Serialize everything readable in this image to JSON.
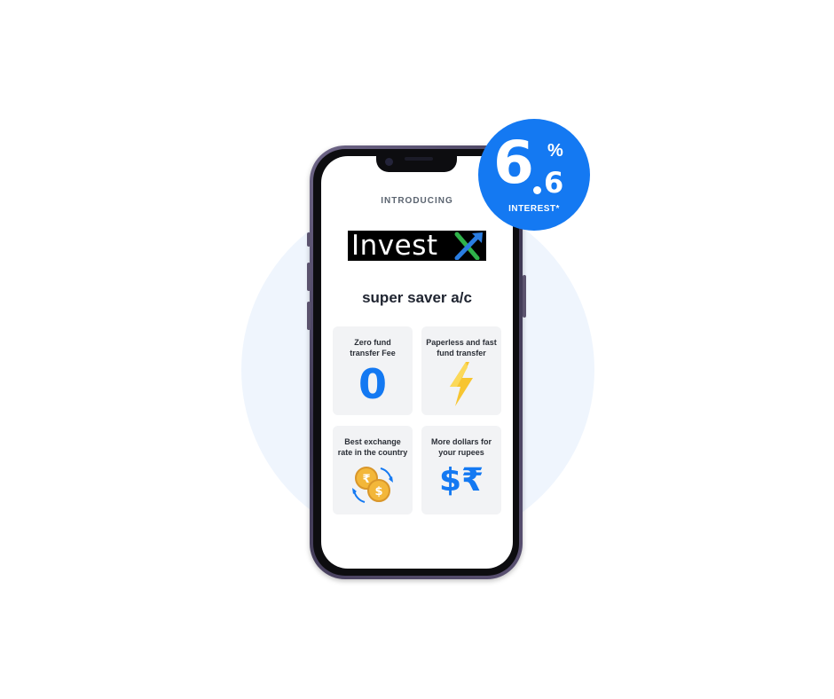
{
  "promo": {
    "intro_label": "INTRODUCING",
    "brand": {
      "text": "Invest"
    },
    "product_title": "super saver a/c",
    "badge": {
      "rate_major": "6",
      "rate_minor": "6",
      "percent_sign": "%",
      "label": "INTEREST*",
      "color": "#1479f2"
    },
    "features": [
      {
        "title_line1": "Zero fund",
        "title_line2": "transfer Fee",
        "value": "0",
        "icon": "zero-digit"
      },
      {
        "title_line1": "Paperless and fast",
        "title_line2": "fund transfer",
        "icon": "lightning-bolt-icon"
      },
      {
        "title_line1": "Best exchange",
        "title_line2": "rate in the country",
        "icon": "currency-exchange-coins-icon"
      },
      {
        "title_line1": "More dollars for",
        "title_line2": "your rupees",
        "symbols": "$₹",
        "icon": "dollar-rupee-icon"
      }
    ]
  },
  "colors": {
    "accent": "#1479f2",
    "card_background": "#f2f3f5",
    "background_circle": "#eff5fd",
    "coin_gold": "#f3b73a",
    "bolt_yellow": "#f7c531"
  }
}
